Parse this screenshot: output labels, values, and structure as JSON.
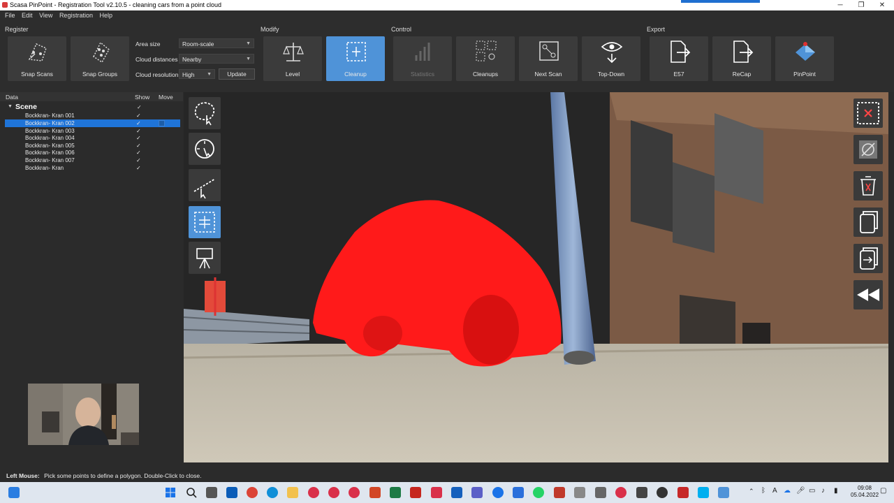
{
  "window": {
    "title": "Scasa PinPoint - Registration Tool v2.10.5 - cleaning cars from a point cloud",
    "minimize": "─",
    "maximize": "❐",
    "close": "✕"
  },
  "menu": {
    "file": "File",
    "edit": "Edit",
    "view": "View",
    "registration": "Registration",
    "help": "Help"
  },
  "ribbon": {
    "groups": {
      "register": "Register",
      "modify": "Modify",
      "control": "Control",
      "export": "Export"
    },
    "snap_scans": "Snap Scans",
    "snap_groups": "Snap Groups",
    "area_size_label": "Area size",
    "area_size_value": "Room-scale",
    "cloud_distances_label": "Cloud distances",
    "cloud_distances_value": "Nearby",
    "cloud_resolution_label": "Cloud resolution",
    "cloud_resolution_value": "High",
    "update": "Update",
    "level": "Level",
    "cleanup": "Cleanup",
    "statistics": "Statistics",
    "cleanups": "Cleanups",
    "next_scan": "Next Scan",
    "top_down": "Top-Down",
    "e57": "E57",
    "recap": "ReCap",
    "pinpoint": "PinPoint"
  },
  "tree": {
    "headers": {
      "data": "Data",
      "show": "Show",
      "move": "Move"
    },
    "scene": "Scene",
    "check": "✓",
    "items": [
      {
        "name": "Bockkran- Kran 001"
      },
      {
        "name": "Bockkran- Kran 002"
      },
      {
        "name": "Bockkran- Kran 003"
      },
      {
        "name": "Bockkran- Kran 004"
      },
      {
        "name": "Bockkran- Kran 005"
      },
      {
        "name": "Bockkran- Kran 006"
      },
      {
        "name": "Bockkran- Kran 007"
      },
      {
        "name": "Bockkran- Kran"
      }
    ]
  },
  "status": {
    "label": "Left Mouse:",
    "text": "Pick some points to define a polygon. Double-Click to close."
  },
  "taskbar": {
    "time": "09:08",
    "date": "05.04.2022"
  },
  "colors": {
    "accent": "#4f93d8",
    "selection": "#1f74d8",
    "car_highlight": "#ff1a1a"
  }
}
